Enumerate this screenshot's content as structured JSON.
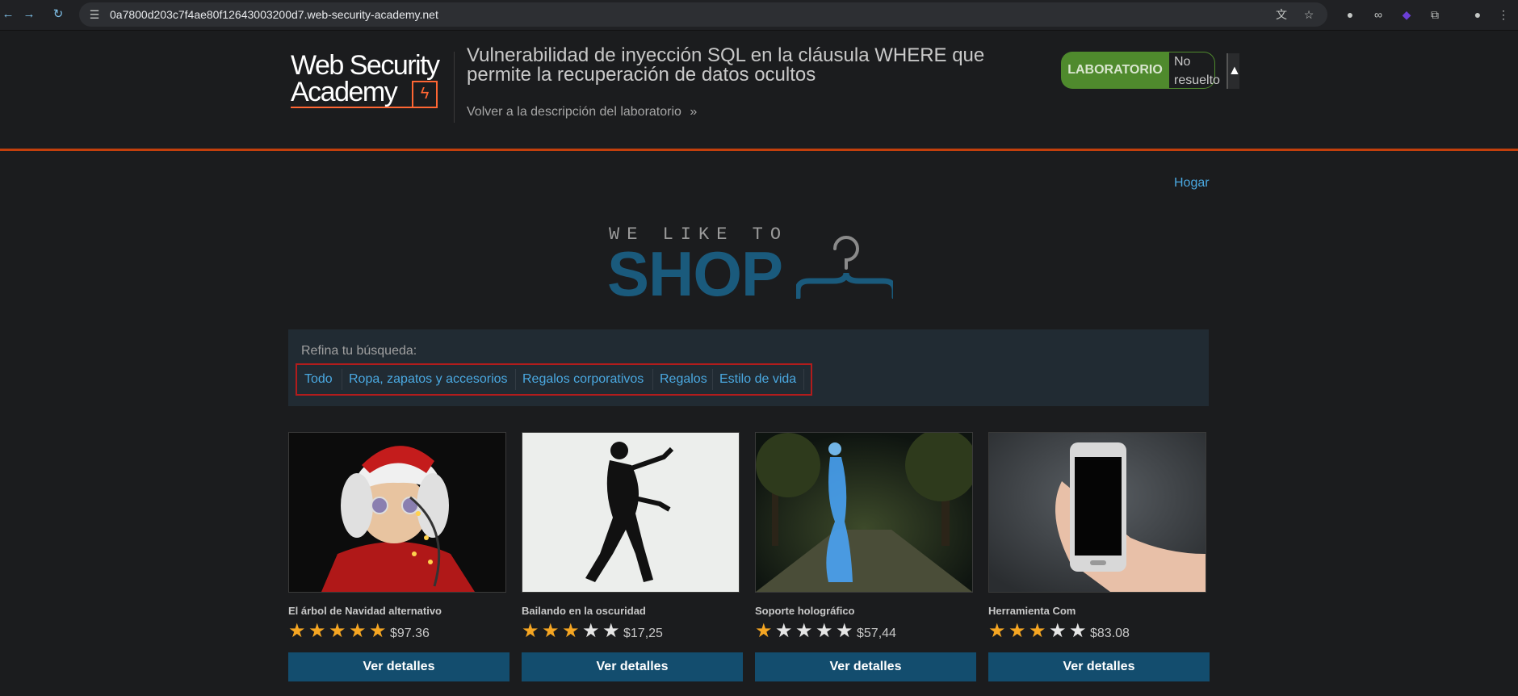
{
  "browser": {
    "url": "0a7800d203c7f4ae80f12643003200d7.web-security-academy.net",
    "back_icon": "back-arrow-icon",
    "forward_icon": "forward-arrow-icon",
    "reload_icon": "reload-icon"
  },
  "lab": {
    "logo_line1": "Web Security",
    "logo_line2": "Academy",
    "title": "Vulnerabilidad de inyección SQL en la cláusula WHERE que permite la recuperación de datos ocultos",
    "back_link": "Volver a la descripción del laboratorio",
    "back_chevron": "»",
    "badge_label": "LABORATORIO",
    "status": "No resuelto"
  },
  "shop": {
    "home_link": "Hogar",
    "logo_tagline": "WE LIKE TO",
    "logo_word": "SHOP",
    "filter_label": "Refina tu búsqueda:",
    "categories": [
      "Todo",
      "Ropa, zapatos y accesorios",
      "Regalos corporativos",
      "Regalos",
      "Estilo de vida"
    ],
    "products": [
      {
        "name": "El árbol de Navidad alternativo",
        "rating": 5,
        "price": "$97.36",
        "button": "Ver detalles"
      },
      {
        "name": "Bailando en la oscuridad",
        "rating": 3,
        "price": "$17,25",
        "button": "Ver detalles"
      },
      {
        "name": "Soporte holográfico",
        "rating": 1,
        "price": "$57,44",
        "button": "Ver detalles"
      },
      {
        "name": "Herramienta Com",
        "rating": 3,
        "price": "$83.08",
        "button": "Ver detalles"
      }
    ]
  },
  "colors": {
    "star_on": "#f5a623",
    "star_off": "#e6e6e6",
    "accent_orange": "#c33f0c",
    "link_blue": "#4aa8e0",
    "button_blue": "#134d6e",
    "lab_green": "#4f8a2d"
  }
}
